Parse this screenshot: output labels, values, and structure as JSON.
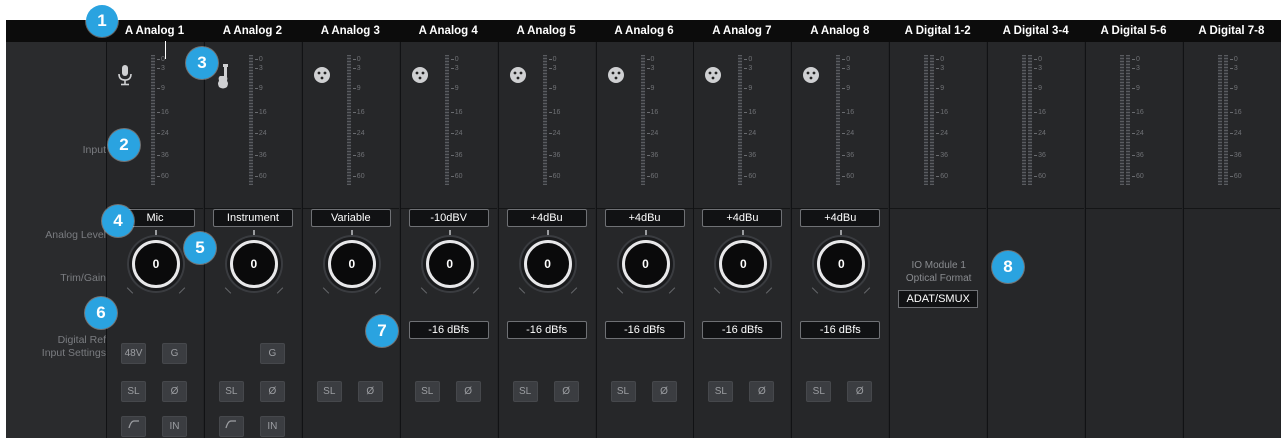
{
  "columns": [
    {
      "title": "A Analog 1",
      "type": "analog",
      "source": "mic-icon",
      "level": "Mic",
      "gain": "0",
      "has_ref": false,
      "buttons": [
        [
          "48V",
          "G"
        ],
        [
          "SL",
          "Ø"
        ],
        [
          "hpf",
          "IN"
        ]
      ]
    },
    {
      "title": "A Analog 2",
      "type": "analog",
      "source": "guitar-icon",
      "level": "Instrument",
      "gain": "0",
      "has_ref": false,
      "buttons": [
        [
          null,
          "G"
        ],
        [
          "SL",
          "Ø"
        ],
        [
          "hpf",
          "IN"
        ]
      ]
    },
    {
      "title": "A Analog 3",
      "type": "analog",
      "source": "xlr-icon",
      "level": "Variable",
      "gain": "0",
      "has_ref": false,
      "buttons": [
        [
          null,
          null
        ],
        [
          "SL",
          "Ø"
        ]
      ]
    },
    {
      "title": "A Analog 4",
      "type": "analog",
      "source": "xlr-icon",
      "level": "-10dBV",
      "gain": "0",
      "has_ref": true,
      "ref": "-16 dBfs",
      "buttons": [
        [
          null,
          null
        ],
        [
          "SL",
          "Ø"
        ]
      ]
    },
    {
      "title": "A Analog 5",
      "type": "analog",
      "source": "xlr-icon",
      "level": "+4dBu",
      "gain": "0",
      "has_ref": true,
      "ref": "-16 dBfs",
      "buttons": [
        [
          null,
          null
        ],
        [
          "SL",
          "Ø"
        ]
      ]
    },
    {
      "title": "A Analog 6",
      "type": "analog",
      "source": "xlr-icon",
      "level": "+4dBu",
      "gain": "0",
      "has_ref": true,
      "ref": "-16 dBfs",
      "buttons": [
        [
          null,
          null
        ],
        [
          "SL",
          "Ø"
        ]
      ]
    },
    {
      "title": "A Analog 7",
      "type": "analog",
      "source": "xlr-icon",
      "level": "+4dBu",
      "gain": "0",
      "has_ref": true,
      "ref": "-16 dBfs",
      "buttons": [
        [
          null,
          null
        ],
        [
          "SL",
          "Ø"
        ]
      ]
    },
    {
      "title": "A Analog 8",
      "type": "analog",
      "source": "xlr-icon",
      "level": "+4dBu",
      "gain": "0",
      "has_ref": true,
      "ref": "-16 dBfs",
      "buttons": [
        [
          null,
          null
        ],
        [
          "SL",
          "Ø"
        ]
      ]
    },
    {
      "title": "A Digital 1-2",
      "type": "digital",
      "optical": true
    },
    {
      "title": "A Digital 3-4",
      "type": "digital"
    },
    {
      "title": "A Digital 5-6",
      "type": "digital"
    },
    {
      "title": "A Digital 7-8",
      "type": "digital"
    }
  ],
  "row_labels": {
    "input": "Input",
    "analog_level": "Analog Level",
    "trim_gain": "Trim/Gain",
    "digital_ref_line1": "Digital Ref",
    "digital_ref_line2": "Input Settings"
  },
  "meter_scale": [
    "0",
    "3",
    "9",
    "16",
    "24",
    "36",
    "60"
  ],
  "optical": {
    "line1": "IO Module 1",
    "line2": "Optical Format",
    "value": "ADAT/SMUX"
  },
  "callouts": [
    "1",
    "2",
    "3",
    "4",
    "5",
    "6",
    "7",
    "8"
  ],
  "colors": {
    "accent": "#2aa3e0",
    "background": "#222325",
    "header": "#0c0c0c"
  }
}
